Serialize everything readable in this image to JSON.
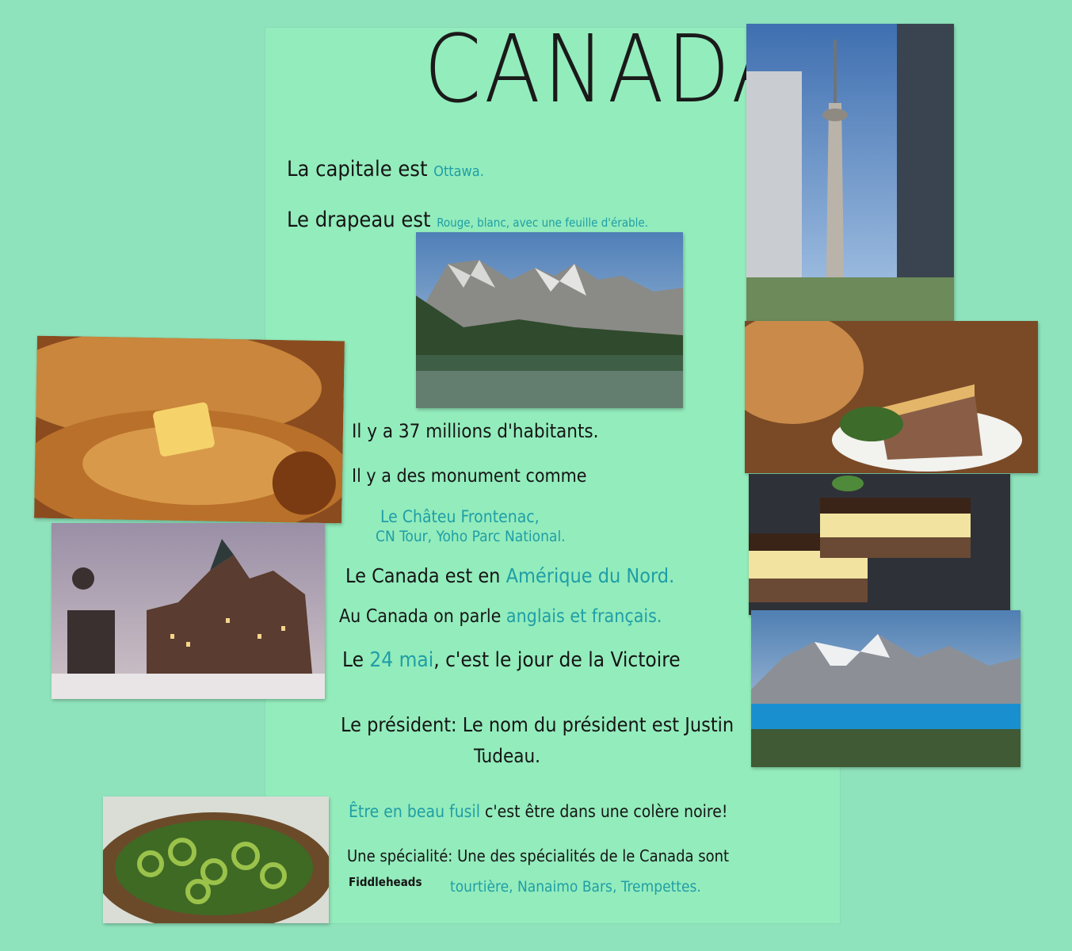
{
  "title": "CANADA",
  "capital": {
    "label": "La capitale est",
    "value": "Ottawa."
  },
  "flag": {
    "label": "Le drapeau est",
    "value": "Rouge, blanc, avec une feuille d'érable."
  },
  "population": "Il y a 37 millions d'habitants.",
  "monuments": {
    "label": "Il y a des monument comme",
    "line1": "Le Châteu Frontenac,",
    "line2": "CN Tour, Yoho Parc National."
  },
  "continent": {
    "label": "Le Canada est en",
    "value": "Amérique du Nord."
  },
  "languages": {
    "label": "Au Canada on parle",
    "value": "anglais et français."
  },
  "holiday": {
    "pre": "Le",
    "date": "24 mai",
    "post": ", c'est le jour de la Victoire"
  },
  "president": {
    "label": "Le président:",
    "line1": "Le nom du président est Justin",
    "line2": "Tudeau."
  },
  "expression": {
    "phrase": "Être en beau fusil",
    "meaning": "c'est être dans une colère noire!"
  },
  "specialty": {
    "label": "Une spécialité:",
    "line1": "Une des spécialités de le Canada sont",
    "prefix": "Fiddleheads",
    "items": "tourtière, Nanaimo Bars, Trempettes."
  },
  "colors": {
    "background": "#8fe3bc",
    "poster": "#93ecbc",
    "ink": "#151515",
    "teal": "#1f9ea6"
  }
}
